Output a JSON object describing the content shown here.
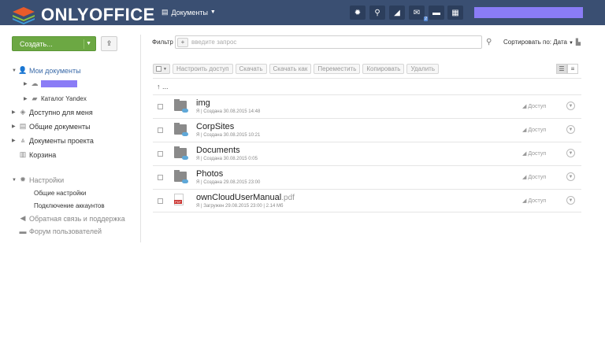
{
  "header": {
    "logo_text": "ONLYOFFICE",
    "module_label": "Документы",
    "icons": [
      "gear-icon",
      "search-icon",
      "feed-icon",
      "mail-icon",
      "chat-icon",
      "calendar-icon"
    ],
    "mail_badge": "2"
  },
  "sidebar": {
    "create_label": "Создать...",
    "my_documents": "Мои документы",
    "yandex_catalog": "Каталог Yandex",
    "shared_with_me": "Доступно для меня",
    "common_documents": "Общие документы",
    "project_documents": "Документы проекта",
    "trash": "Корзина",
    "settings": "Настройки",
    "general_settings": "Общие настройки",
    "connect_accounts": "Подключение аккаунтов",
    "feedback": "Обратная связь и поддержка",
    "forum": "Форум пользователей"
  },
  "filter": {
    "label": "Фильтр",
    "placeholder": "введите запрос",
    "sort_label": "Сортировать по: Дата"
  },
  "toolbar": {
    "share": "Настроить доступ",
    "download": "Скачать",
    "download_as": "Скачать как",
    "move": "Переместить",
    "copy": "Копировать",
    "delete": "Удалить"
  },
  "up_label": "...",
  "files": [
    {
      "name": "img",
      "ext": "",
      "meta": "Я | Создана 30.08.2015 14:48",
      "access": "Доступ",
      "type": "folder"
    },
    {
      "name": "CorpSites",
      "ext": "",
      "meta": "Я | Создана 30.08.2015 10:21",
      "access": "Доступ",
      "type": "folder"
    },
    {
      "name": "Documents",
      "ext": "",
      "meta": "Я | Создана 30.08.2015 0:05",
      "access": "Доступ",
      "type": "folder"
    },
    {
      "name": "Photos",
      "ext": "",
      "meta": "Я | Создана 29.08.2015 23:00",
      "access": "Доступ",
      "type": "folder"
    },
    {
      "name": "ownCloudUserManual",
      "ext": ".pdf",
      "meta": "Я | Загружен 29.08.2015 23:00 | 2.14 Мб",
      "access": "Доступ",
      "type": "pdf"
    }
  ],
  "colors": {
    "topbar": "#3a4f72",
    "create_button": "#6ca843",
    "active_link": "#3a6aa8",
    "redacted": "#8a7cf6"
  }
}
